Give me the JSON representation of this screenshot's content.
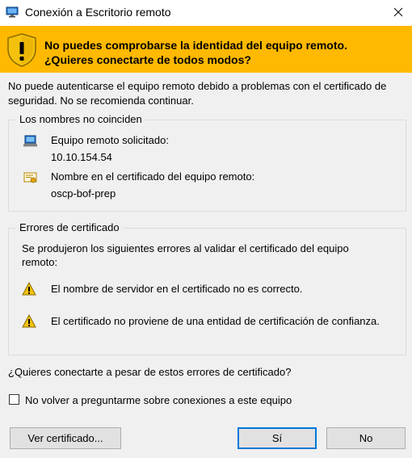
{
  "window": {
    "title": "Conexión a Escritorio remoto",
    "app_icon": "remote-desktop-icon",
    "close_icon": "close-icon"
  },
  "banner": {
    "icon": "warning-shield-icon",
    "line1": "No puedes comprobarse la identidad del equipo remoto.",
    "line2": "¿Quieres conectarte de todos modos?",
    "color": "#ffb900"
  },
  "intro": {
    "line1": "No puede autenticarse el equipo remoto debido a problemas con el certificado de",
    "line2": "seguridad. No se recomienda continuar."
  },
  "names_group": {
    "legend": "Los nombres no coinciden",
    "requested_label": "Equipo remoto solicitado:",
    "requested_value": "10.10.154.54",
    "cert_label": "Nombre en el certificado del equipo remoto:",
    "cert_value": "oscp-bof-prep"
  },
  "errors_group": {
    "legend": "Errores de certificado",
    "desc_line1": "Se produjeron los siguientes errores al validar el certificado del equipo",
    "desc_line2": "remoto:",
    "errors": [
      "El nombre de servidor en el certificado no es correcto.",
      "El certificado no proviene de una entidad de certificación de confianza."
    ]
  },
  "question": "¿Quieres conectarte a pesar de estos errores de certificado?",
  "checkbox": {
    "label": "No volver a preguntarme sobre conexiones a este equipo",
    "checked": false
  },
  "buttons": {
    "view_cert": "Ver certificado...",
    "yes": "Sí",
    "no": "No"
  }
}
